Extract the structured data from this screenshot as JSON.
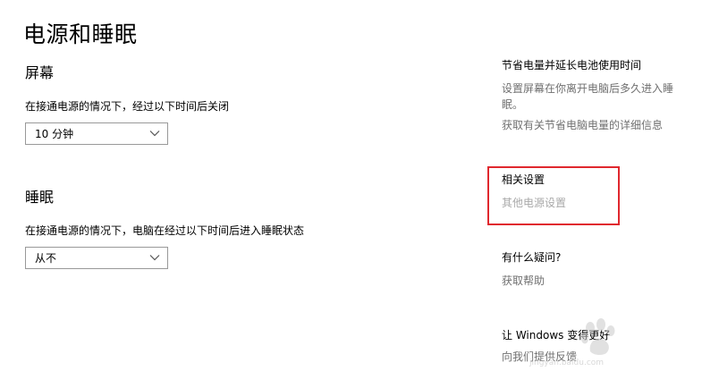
{
  "page": {
    "title": "电源和睡眠"
  },
  "screen": {
    "heading": "屏幕",
    "description": "在接通电源的情况下，经过以下时间后关闭",
    "dropdown_value": "10 分钟"
  },
  "sleep": {
    "heading": "睡眠",
    "description": "在接通电源的情况下，电脑在经过以下时间后进入睡眠状态",
    "dropdown_value": "从不"
  },
  "side": {
    "battery": {
      "heading": "节省电量并延长电池使用时间",
      "text_line1": "设置屏幕在你离开电脑后多久进入睡",
      "text_line2": "眠。",
      "link": "获取有关节省电脑电量的详细信息"
    },
    "related": {
      "heading": "相关设置",
      "link": "其他电源设置"
    },
    "help": {
      "heading": "有什么疑问?",
      "link": "获取帮助"
    },
    "feedback": {
      "heading": "让 Windows 变得更好",
      "link": "向我们提供反馈"
    }
  },
  "watermark": {
    "text": "jingyan.baidu.com",
    "logo_name": "baidu-jingyan-watermark"
  },
  "colors": {
    "highlight_border": "#e0282e",
    "secondary_text": "#707070",
    "dropdown_border": "#999999"
  }
}
